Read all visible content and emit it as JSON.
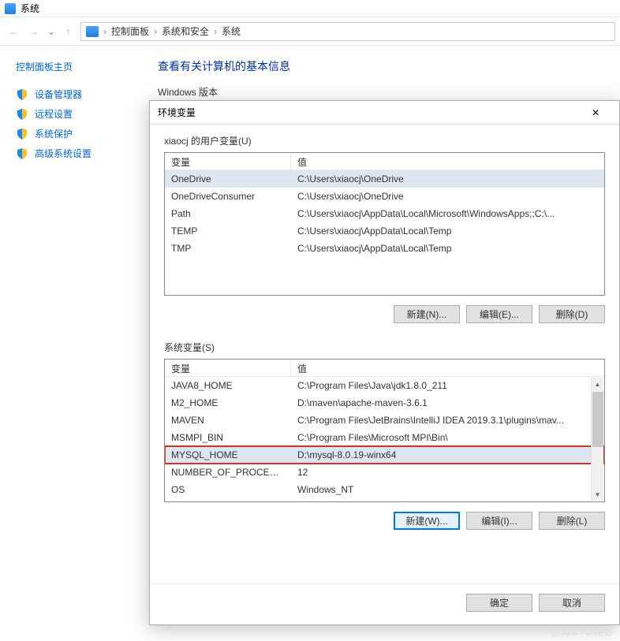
{
  "window": {
    "title": "系统"
  },
  "breadcrumb": {
    "items": [
      "控制面板",
      "系统和安全",
      "系统"
    ]
  },
  "sidebar": {
    "home": "控制面板主页",
    "items": [
      {
        "label": "设备管理器"
      },
      {
        "label": "远程设置"
      },
      {
        "label": "系统保护"
      },
      {
        "label": "高级系统设置"
      }
    ]
  },
  "content": {
    "heading": "查看有关计算机的基本信息",
    "section": "Windows 版本"
  },
  "dialog": {
    "title": "环境变量",
    "user_section_label": "xiaocj 的用户变量(U)",
    "system_section_label": "系统变量(S)",
    "headers": {
      "name": "变量",
      "value": "值"
    },
    "user_vars": [
      {
        "name": "OneDrive",
        "value": "C:\\Users\\xiaocj\\OneDrive"
      },
      {
        "name": "OneDriveConsumer",
        "value": "C:\\Users\\xiaocj\\OneDrive"
      },
      {
        "name": "Path",
        "value": "C:\\Users\\xiaocj\\AppData\\Local\\Microsoft\\WindowsApps;;C:\\..."
      },
      {
        "name": "TEMP",
        "value": "C:\\Users\\xiaocj\\AppData\\Local\\Temp"
      },
      {
        "name": "TMP",
        "value": "C:\\Users\\xiaocj\\AppData\\Local\\Temp"
      }
    ],
    "system_vars": [
      {
        "name": "JAVA8_HOME",
        "value": "C:\\Program Files\\Java\\jdk1.8.0_211"
      },
      {
        "name": "M2_HOME",
        "value": "D:\\maven\\apache-maven-3.6.1"
      },
      {
        "name": "MAVEN",
        "value": "C:\\Program Files\\JetBrains\\IntelliJ IDEA 2019.3.1\\plugins\\mav..."
      },
      {
        "name": "MSMPI_BIN",
        "value": "C:\\Program Files\\Microsoft MPI\\Bin\\"
      },
      {
        "name": "MYSQL_HOME",
        "value": "D:\\mysql-8.0.19-winx64"
      },
      {
        "name": "NUMBER_OF_PROCESSORS",
        "value": "12"
      },
      {
        "name": "OS",
        "value": "Windows_NT"
      }
    ],
    "buttons": {
      "user_new": "新建(N)...",
      "user_edit": "编辑(E)...",
      "user_delete": "删除(D)",
      "sys_new": "新建(W)...",
      "sys_edit": "编辑(I)...",
      "sys_delete": "删除(L)",
      "ok": "确定",
      "cancel": "取消"
    }
  },
  "watermark": "@51CTO博客"
}
